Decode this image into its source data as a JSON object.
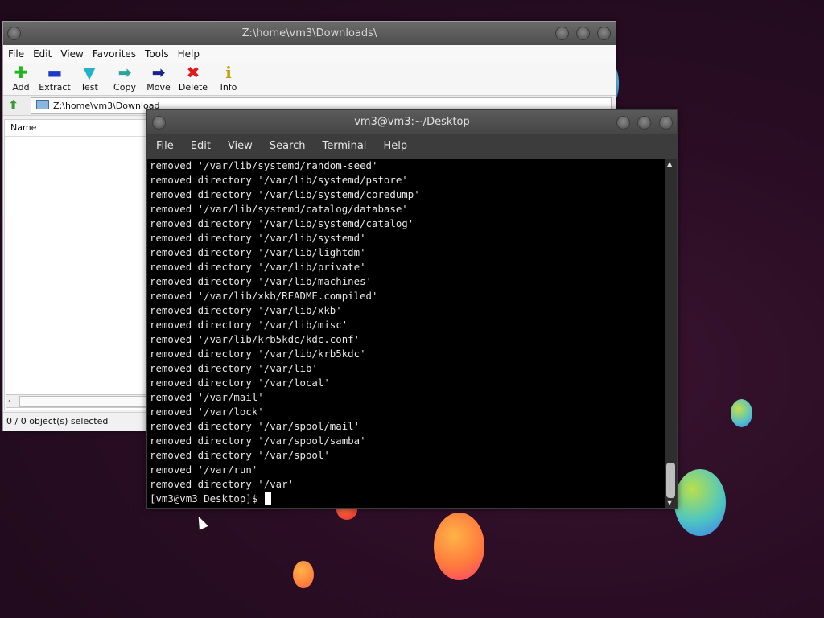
{
  "archiver": {
    "title": "Z:\\home\\vm3\\Downloads\\",
    "menu": [
      "File",
      "Edit",
      "View",
      "Favorites",
      "Tools",
      "Help"
    ],
    "toolbar": [
      {
        "label": "Add",
        "icon": "plus-icon",
        "glyph": "✚",
        "color": "#22b422"
      },
      {
        "label": "Extract",
        "icon": "minus-icon",
        "glyph": "▬",
        "color": "#1a39c8"
      },
      {
        "label": "Test",
        "icon": "check-arrow-icon",
        "glyph": "▼",
        "color": "#22b3c8"
      },
      {
        "label": "Copy",
        "icon": "copy-arrow-icon",
        "glyph": "➡",
        "color": "#2aa59a"
      },
      {
        "label": "Move",
        "icon": "move-arrow-icon",
        "glyph": "➡",
        "color": "#17238f"
      },
      {
        "label": "Delete",
        "icon": "delete-x-icon",
        "glyph": "✖",
        "color": "#e01a1a"
      },
      {
        "label": "Info",
        "icon": "info-icon",
        "glyph": "i",
        "color": "#c69a0c"
      }
    ],
    "address": "Z:\\home\\vm3\\Download",
    "column_name": "Name",
    "status": "0 / 0 object(s) selected"
  },
  "terminal": {
    "title": "vm3@vm3:~/Desktop",
    "menu": [
      "File",
      "Edit",
      "View",
      "Search",
      "Terminal",
      "Help"
    ],
    "lines": [
      "removed '/var/lib/systemd/random-seed'",
      "removed directory '/var/lib/systemd/pstore'",
      "removed directory '/var/lib/systemd/coredump'",
      "removed '/var/lib/systemd/catalog/database'",
      "removed directory '/var/lib/systemd/catalog'",
      "removed directory '/var/lib/systemd'",
      "removed directory '/var/lib/lightdm'",
      "removed directory '/var/lib/private'",
      "removed directory '/var/lib/machines'",
      "removed '/var/lib/xkb/README.compiled'",
      "removed directory '/var/lib/xkb'",
      "removed directory '/var/lib/misc'",
      "removed '/var/lib/krb5kdc/kdc.conf'",
      "removed directory '/var/lib/krb5kdc'",
      "removed directory '/var/lib'",
      "removed directory '/var/local'",
      "removed '/var/mail'",
      "removed '/var/lock'",
      "removed directory '/var/spool/mail'",
      "removed directory '/var/spool/samba'",
      "removed directory '/var/spool'",
      "removed '/var/run'",
      "removed directory '/var'"
    ],
    "prompt": "[vm3@vm3 Desktop]$ "
  }
}
